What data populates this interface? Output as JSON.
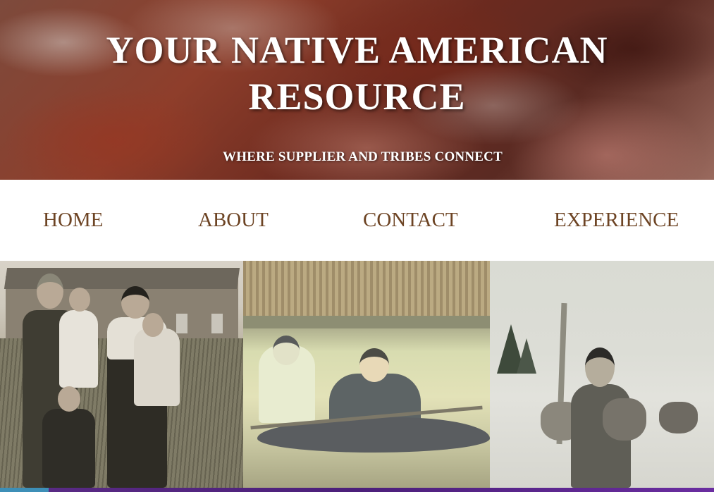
{
  "header": {
    "title_line1": "YOUR NATIVE AMERICAN",
    "title_line2": "RESOURCE",
    "tagline": "WHERE SUPPLIER AND TRIBES CONNECT"
  },
  "nav": {
    "items": [
      {
        "label": "HOME"
      },
      {
        "label": "ABOUT"
      },
      {
        "label": "CONTACT"
      },
      {
        "label": "EXPERIENCE"
      }
    ]
  },
  "colors": {
    "nav_text": "#6d4424",
    "title_text": "#ffffff",
    "footer_bar": "#4b1f7a",
    "footer_widget": "#3d8fb7"
  }
}
